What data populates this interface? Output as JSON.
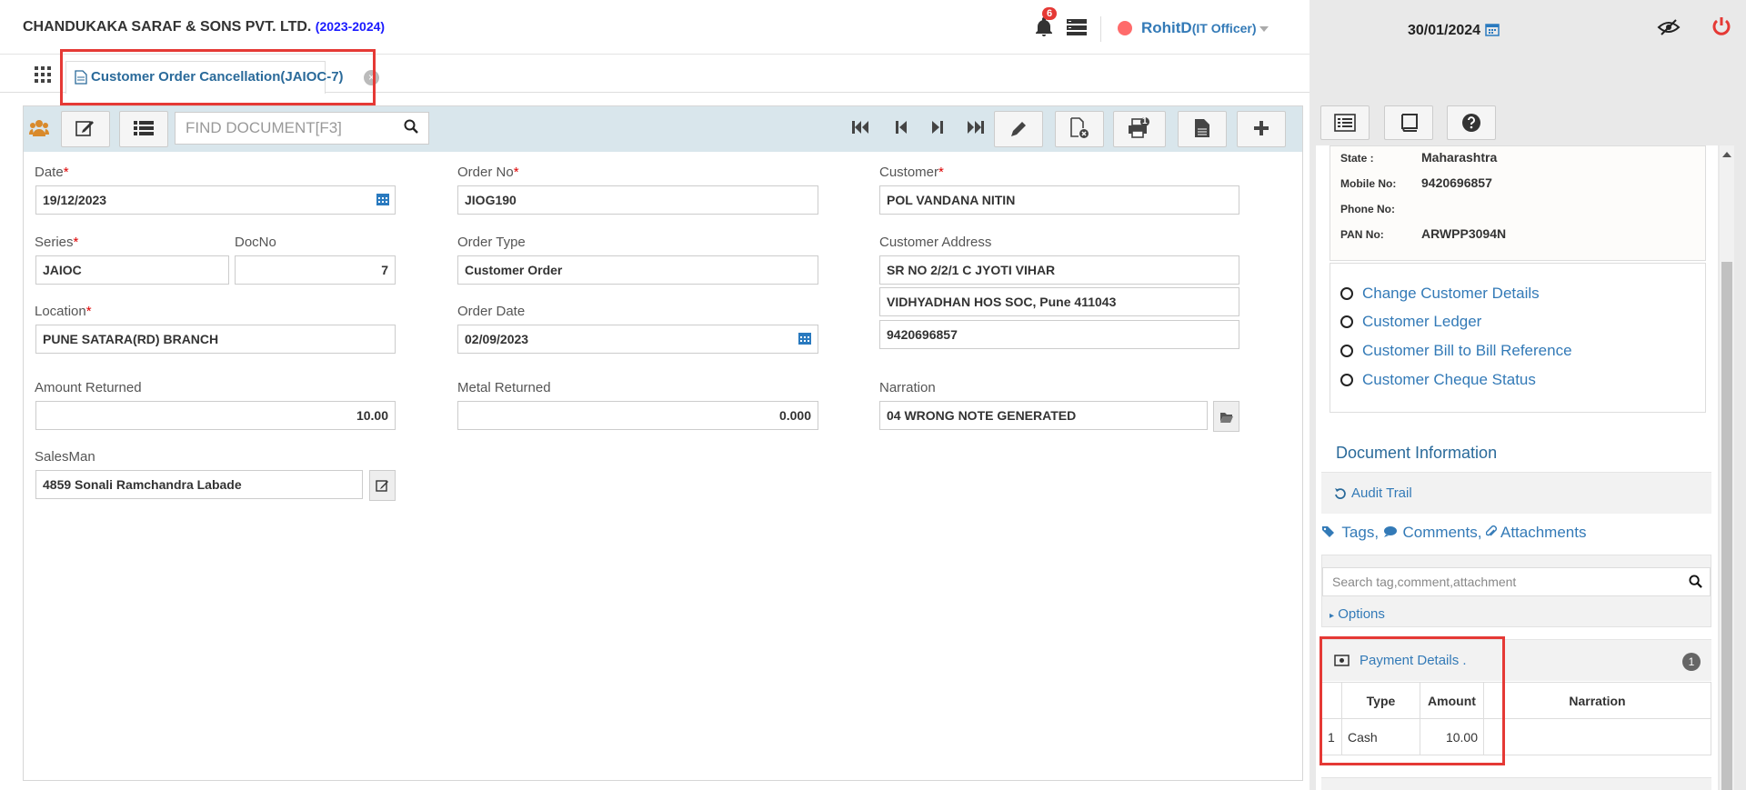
{
  "header": {
    "company": "CHANDUKAKA SARAF & SONS PVT. LTD.",
    "year": "(2023-2024)",
    "notifications": "6",
    "username": "RohitD",
    "role": "(IT Officer)",
    "date": "30/01/2024"
  },
  "tab": {
    "label": "Customer Order Cancellation(JAIOC-7)"
  },
  "toolbar": {
    "find_placeholder": "FIND DOCUMENT[F3]",
    "print_badge": "1"
  },
  "form": {
    "date_label": "Date",
    "date": "19/12/2023",
    "order_no_label": "Order No",
    "order_no": "JIOG190",
    "customer_label": "Customer",
    "customer": "POL VANDANA NITIN",
    "series_label": "Series",
    "series": "JAIOC",
    "docno_label": "DocNo",
    "docno": "7",
    "order_type_label": "Order Type",
    "order_type": "Customer Order",
    "cust_addr_label": "Customer Address",
    "addr1": "SR NO 2/2/1 C JYOTI VIHAR",
    "addr2": "VIDHYADHAN HOS SOC, Pune 411043",
    "addr3": "9420696857",
    "location_label": "Location",
    "location": "PUNE SATARA(RD) BRANCH",
    "order_date_label": "Order Date",
    "order_date": "02/09/2023",
    "amount_label": "Amount Returned",
    "amount": "10.00",
    "metal_label": "Metal Returned",
    "metal": "0.000",
    "narration_label": "Narration",
    "narration": "04 WRONG NOTE GENERATED",
    "salesman_label": "SalesMan",
    "salesman": "4859 Sonali Ramchandra Labade"
  },
  "customer_card": {
    "state_k": "State :",
    "state_v": "Maharashtra",
    "mobile_k": "Mobile No:",
    "mobile_v": "9420696857",
    "phone_k": "Phone No:",
    "phone_v": "",
    "pan_k": "PAN No:",
    "pan_v": "ARWPP3094N"
  },
  "links": [
    "Change Customer Details",
    "Customer Ledger",
    "Customer Bill to Bill Reference",
    "Customer Cheque Status"
  ],
  "docinfo": {
    "title": "Document Information",
    "audit": "Audit Trail",
    "tags": "Tags,",
    "comments": "Comments,",
    "attachments": "Attachments",
    "search_placeholder": "Search tag,comment,attachment",
    "options": "Options"
  },
  "payment": {
    "title": "Payment Details .",
    "count": "1",
    "headers": [
      "Type",
      "Amount",
      "Narration"
    ],
    "rows": [
      {
        "n": "1",
        "type": "Cash",
        "amount": "10.00",
        "narration": ""
      }
    ]
  }
}
